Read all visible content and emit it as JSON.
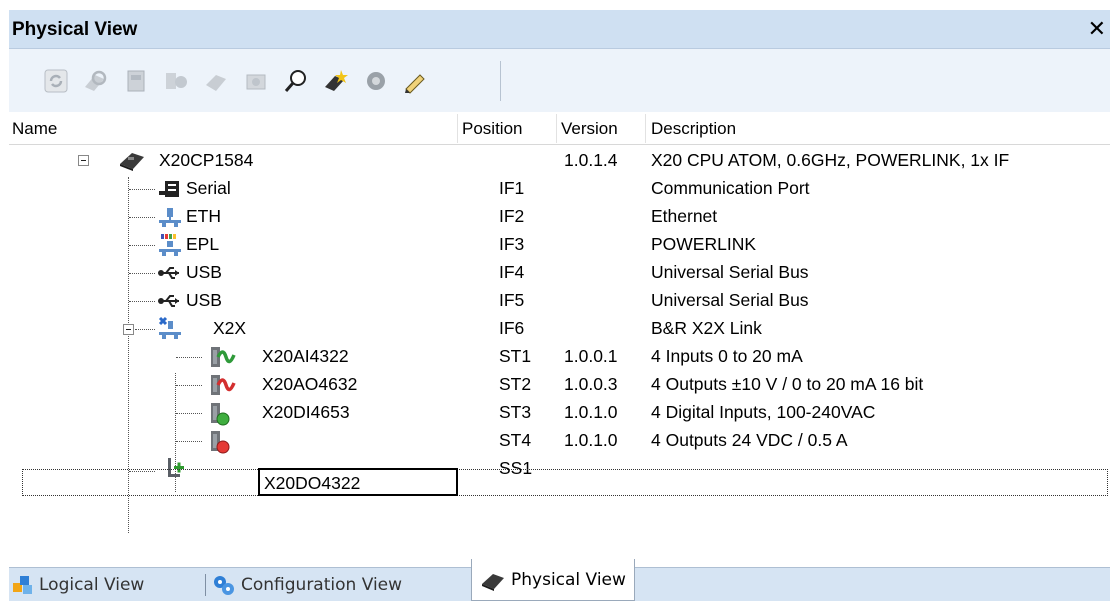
{
  "window": {
    "title": "Physical View"
  },
  "toolbar": {
    "buttons": [
      "refresh-icon",
      "search-network-icon",
      "module-props-icon",
      "module-config-icon",
      "add-module-icon",
      "node-settings-icon",
      "find-icon",
      "insert-module-icon",
      "network-icon",
      "edit-icon"
    ]
  },
  "columns": {
    "name": "Name",
    "position": "Position",
    "version": "Version",
    "description": "Description"
  },
  "rows": [
    {
      "name": "X20CP1584",
      "position": "",
      "version": "1.0.1.4",
      "description": "X20 CPU ATOM, 0.6GHz, POWERLINK, 1x IF"
    },
    {
      "name": "Serial",
      "position": "IF1",
      "version": "",
      "description": "Communication Port"
    },
    {
      "name": "ETH",
      "position": "IF2",
      "version": "",
      "description": "Ethernet"
    },
    {
      "name": "EPL",
      "position": "IF3",
      "version": "",
      "description": "POWERLINK"
    },
    {
      "name": "USB",
      "position": "IF4",
      "version": "",
      "description": "Universal Serial Bus"
    },
    {
      "name": "USB",
      "position": "IF5",
      "version": "",
      "description": "Universal Serial Bus"
    },
    {
      "name": "X2X",
      "position": "IF6",
      "version": "",
      "description": "B&R X2X Link"
    },
    {
      "name": "X20AI4322",
      "position": "ST1",
      "version": "1.0.0.1",
      "description": "4 Inputs 0 to 20 mA"
    },
    {
      "name": "X20AO4632",
      "position": "ST2",
      "version": "1.0.0.3",
      "description": "4 Outputs ±10 V / 0 to 20 mA  16 bit"
    },
    {
      "name": "X20DI4653",
      "position": "ST3",
      "version": "1.0.1.0",
      "description": "4 Digital Inputs, 100-240VAC"
    },
    {
      "name": "X20DO4322",
      "position": "ST4",
      "version": "1.0.1.0",
      "description": "4 Outputs 24 VDC / 0.5 A"
    },
    {
      "name": "",
      "position": "SS1",
      "version": "",
      "description": ""
    }
  ],
  "tabs": [
    {
      "label": "Logical View",
      "active": false
    },
    {
      "label": "Configuration View",
      "active": false
    },
    {
      "label": "Physical View",
      "active": true
    }
  ],
  "colors": {
    "titlebar": "#cfe0f2",
    "toolbar": "#edf3fa",
    "tabbar": "#d6e4f3"
  }
}
